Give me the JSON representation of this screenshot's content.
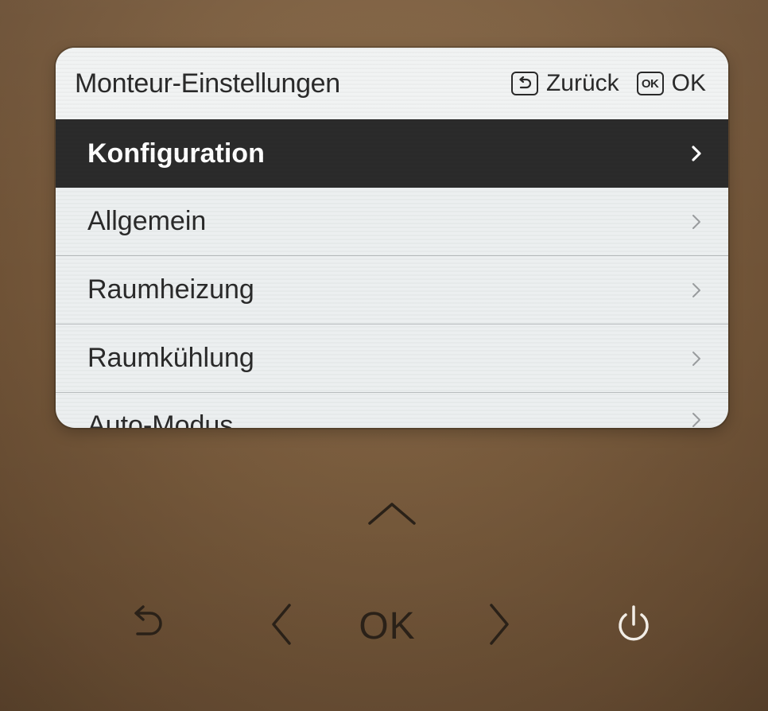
{
  "screen": {
    "header": {
      "title": "Monteur-Einstellungen",
      "back_hint_label": "Zurück",
      "ok_hint_key": "OK",
      "ok_hint_label": "OK"
    },
    "menu": {
      "selected_index": 0,
      "items": [
        {
          "label": "Konfiguration",
          "icon": "chevron-right-icon"
        },
        {
          "label": "Allgemein",
          "icon": "chevron-right-icon"
        },
        {
          "label": "Raumheizung",
          "icon": "chevron-right-icon"
        },
        {
          "label": "Raumkühlung",
          "icon": "chevron-right-icon"
        },
        {
          "label": "Auto-Modus",
          "icon": "chevron-right-icon"
        }
      ]
    }
  },
  "hardware_buttons": {
    "up": {
      "icon": "chevron-up-icon"
    },
    "back": {
      "icon": "back-arrow-icon"
    },
    "left": {
      "icon": "chevron-left-icon"
    },
    "ok": {
      "label": "OK"
    },
    "right": {
      "icon": "chevron-right-icon"
    },
    "power": {
      "icon": "power-icon",
      "color": "#f2ede6"
    }
  },
  "colors": {
    "selected_row_bg": "#2b2b2b",
    "screen_bg": "#eceff0",
    "device_body": "#7a5c3d"
  }
}
